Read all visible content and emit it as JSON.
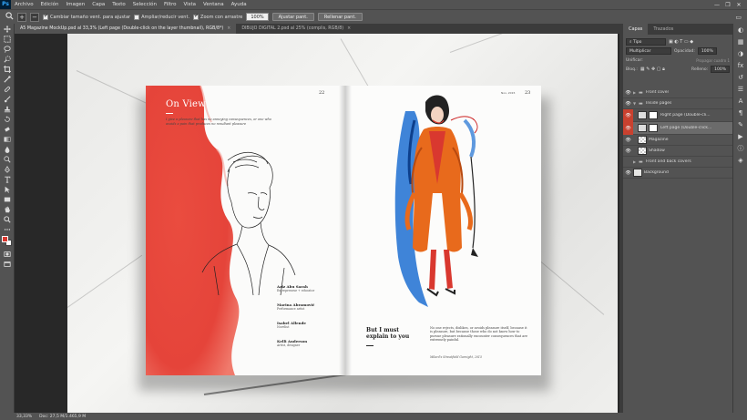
{
  "app": {
    "logo": "Ps"
  },
  "menu": [
    "Archivo",
    "Edición",
    "Imagen",
    "Capa",
    "Texto",
    "Selección",
    "Filtro",
    "Vista",
    "Ventana",
    "Ayuda"
  ],
  "window_controls": [
    "—",
    "❐",
    "✕"
  ],
  "options": {
    "resize_windows": "Cambiar tamaño vent. para ajustar",
    "zoom_all": "Ampliar/reducir vent.",
    "scrubby": "Zoom con arrastre",
    "zoom_value": "100%",
    "fit_screen": "Ajustar pant.",
    "fill_screen": "Rellenar pant."
  },
  "tabs": [
    {
      "label": "A5 Magazine MockUp.psd al 33,3% (Left page (Double-click on the layer thumbnail), RGB/8*)",
      "close": "×"
    },
    {
      "label": "DIBUJO DIGITAL 2.psd al 25% (complis, RGB/8)",
      "close": "×"
    }
  ],
  "magazine": {
    "left_page": {
      "number": "22",
      "title": "On View",
      "intro": "I give a pleasure that has no annoying consequences, or one who avoids a pain that produces no resultant pleasure",
      "credits": [
        {
          "name": "Aziz Abu Sarah",
          "role": "Entrepreneur + educator"
        },
        {
          "name": "Marina Abramović",
          "role": "Performance artist"
        },
        {
          "name": "Isabel Allende",
          "role": "Novelist"
        },
        {
          "name": "Kelli Anderson",
          "role": "Artist, designer"
        }
      ]
    },
    "right_page": {
      "number": "23",
      "date": "Nov, 2015",
      "heading": "But I must explain to you",
      "body": "No one rejects, dislikes, or avoids pleasure itself, because it is pleasure, but because those who do not know how to pursue pleasure rationally encounter consequences that are extremely painful.",
      "source": "Milard's Streatfield Garnight, 2015"
    }
  },
  "status": {
    "zoom": "33,33%",
    "doc": "Doc: 27,5 M/1.465,9 M"
  },
  "panel": {
    "tabs": [
      "Capas",
      "Trazados"
    ],
    "search_placeholder": "Tipo",
    "blend_mode": "Multiplicar",
    "opacity_label": "Opacidad:",
    "opacity_value": "100%",
    "unify_label": "Unificar:",
    "propagate_label": "Propagar cuadro 1",
    "lock_label": "Bloq.:",
    "fill_label": "Relleno:",
    "fill_value": "100%",
    "layers": [
      {
        "name": "Front cover",
        "type": "group",
        "indent": 0,
        "visible": true
      },
      {
        "name": "Inside pages",
        "type": "group",
        "indent": 0,
        "visible": true
      },
      {
        "name": "Right page (Double-cli...",
        "type": "smart",
        "indent": 1,
        "visible": true,
        "selected": false
      },
      {
        "name": "Left page (Double-click...",
        "type": "smart",
        "indent": 1,
        "visible": true,
        "selected": true
      },
      {
        "name": "Magazine",
        "type": "layer",
        "indent": 1,
        "visible": true
      },
      {
        "name": "Shadow",
        "type": "layer",
        "indent": 1,
        "visible": true
      },
      {
        "name": "Front and back covers",
        "type": "group",
        "indent": 0,
        "visible": false
      },
      {
        "name": "Background",
        "type": "layer",
        "indent": 0,
        "visible": true
      }
    ]
  },
  "colors": {
    "foreground": "#d9382f",
    "background": "#ffffff",
    "accent_red": "#e8463b"
  }
}
